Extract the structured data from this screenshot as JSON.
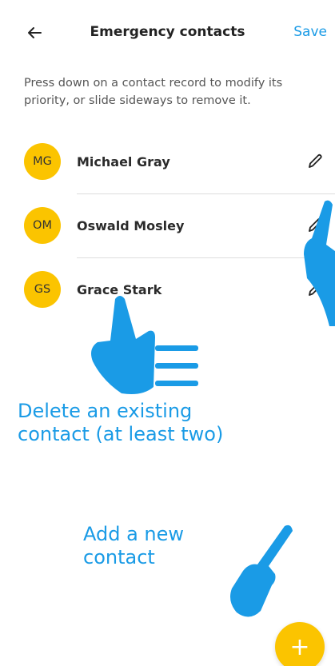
{
  "header": {
    "back_icon": "arrow-left-icon",
    "title": "Emergency contacts",
    "save_label": "Save"
  },
  "instructions": "Press down on a contact record to modify its priority, or slide sideways to remove it.",
  "contacts": [
    {
      "initials": "MG",
      "name": "Michael Gray",
      "edit_icon": "pencil-icon"
    },
    {
      "initials": "OM",
      "name": "Oswald Mosley",
      "edit_icon": "pencil-icon"
    },
    {
      "initials": "GS",
      "name": "Grace Stark",
      "edit_icon": "pencil-icon"
    }
  ],
  "annotations": {
    "delete_note": "Delete an existing contact (at least two)",
    "delete_note_line1": "Delete an existing",
    "delete_note_line2": "contact (at least two)",
    "add_note_line1": "Add a new",
    "add_note_line2": "contact"
  },
  "fab": {
    "label": "+",
    "icon": "plus-icon"
  },
  "colors": {
    "accent": "#1a9be6",
    "avatar": "#fbc400",
    "fab": "#fbc400",
    "divider": "#dddddd"
  }
}
